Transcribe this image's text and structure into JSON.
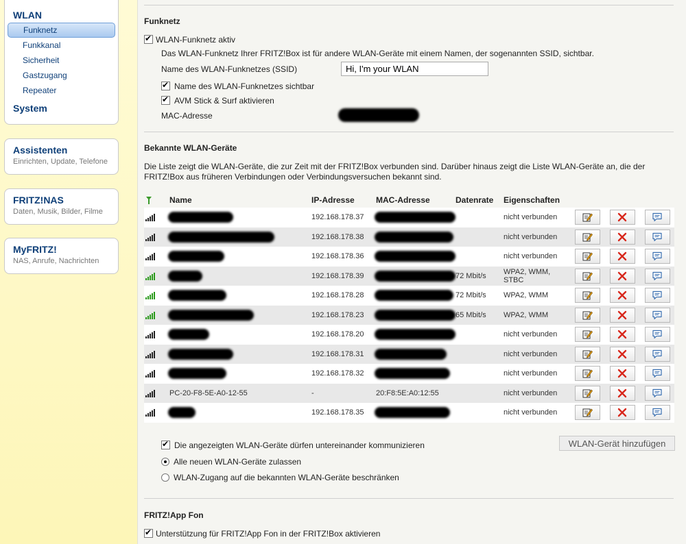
{
  "sidebar": {
    "wlan_heading": "WLAN",
    "wlan_items": [
      "Funknetz",
      "Funkkanal",
      "Sicherheit",
      "Gastzugang",
      "Repeater"
    ],
    "system_heading": "System",
    "cards": [
      {
        "title": "Assistenten",
        "subtitle": "Einrichten, Update, Telefone"
      },
      {
        "title": "FRITZ!NAS",
        "subtitle": "Daten, Musik, Bilder, Filme"
      },
      {
        "title": "MyFRITZ!",
        "subtitle": "NAS, Anrufe, Nachrichten"
      }
    ]
  },
  "funknetz": {
    "heading": "Funknetz",
    "active_label": "WLAN-Funknetz aktiv",
    "description": "Das WLAN-Funknetz Ihrer FRITZ!Box ist für andere WLAN-Geräte mit einem Namen, der sogenannten SSID, sichtbar.",
    "ssid_label": "Name des WLAN-Funknetzes (SSID)",
    "ssid_value": "Hi, I'm your WLAN",
    "visible_label": "Name des WLAN-Funknetzes sichtbar",
    "stick_label": "AVM Stick & Surf aktivieren",
    "mac_label": "MAC-Adresse"
  },
  "devices": {
    "heading": "Bekannte WLAN-Geräte",
    "description": "Die Liste zeigt die WLAN-Geräte, die zur Zeit mit der FRITZ!Box verbunden sind. Darüber hinaus zeigt die Liste WLAN-Geräte an, die der FRITZ!Box aus früheren Verbindungen oder Verbindungsversuchen bekannt sind.",
    "columns": {
      "name": "Name",
      "ip": "IP-Adresse",
      "mac": "MAC-Adresse",
      "rate": "Datenrate",
      "props": "Eigenschaften"
    },
    "rows": [
      {
        "name": "",
        "ip": "192.168.178.37",
        "mac": "",
        "rate": "",
        "props": "nicht verbunden",
        "signal": "black"
      },
      {
        "name": "",
        "ip": "192.168.178.38",
        "mac": "",
        "rate": "",
        "props": "nicht verbunden",
        "signal": "black"
      },
      {
        "name": "",
        "ip": "192.168.178.36",
        "mac": "",
        "rate": "",
        "props": "nicht verbunden",
        "signal": "black"
      },
      {
        "name": "",
        "ip": "192.168.178.39",
        "mac": "",
        "rate": "72 Mbit/s",
        "props": "WPA2, WMM, STBC",
        "signal": "green"
      },
      {
        "name": "",
        "ip": "192.168.178.28",
        "mac": "",
        "rate": "72 Mbit/s",
        "props": "WPA2, WMM",
        "signal": "green"
      },
      {
        "name": "",
        "ip": "192.168.178.23",
        "mac": "",
        "rate": "65 Mbit/s",
        "props": "WPA2, WMM",
        "signal": "green"
      },
      {
        "name": "",
        "ip": "192.168.178.20",
        "mac": "",
        "rate": "",
        "props": "nicht verbunden",
        "signal": "black"
      },
      {
        "name": "",
        "ip": "192.168.178.31",
        "mac": "",
        "rate": "",
        "props": "nicht verbunden",
        "signal": "black"
      },
      {
        "name": "",
        "ip": "192.168.178.32",
        "mac": "",
        "rate": "",
        "props": "nicht verbunden",
        "signal": "black"
      },
      {
        "name": "PC-20-F8-5E-A0-12-55",
        "ip": "-",
        "mac": "20:F8:5E:A0:12:55",
        "rate": "",
        "props": "nicht verbunden",
        "signal": "black"
      },
      {
        "name": "",
        "ip": "192.168.178.35",
        "mac": "",
        "rate": "",
        "props": "nicht verbunden",
        "signal": "black"
      }
    ],
    "communicate_label": "Die angezeigten WLAN-Geräte dürfen untereinander kommunizieren",
    "allow_all_label": "Alle neuen WLAN-Geräte zulassen",
    "restrict_label": "WLAN-Zugang auf die bekannten WLAN-Geräte beschränken",
    "add_button": "WLAN-Gerät hinzufügen"
  },
  "fritzapp": {
    "heading": "FRITZ!App Fon",
    "support_label": "Unterstützung für FRITZ!App Fon in der FRITZ!Box aktivieren"
  },
  "colors": {
    "nav_blue": "#0e3f78",
    "delete_red": "#d8281c",
    "signal_green": "#2a9a1a"
  }
}
